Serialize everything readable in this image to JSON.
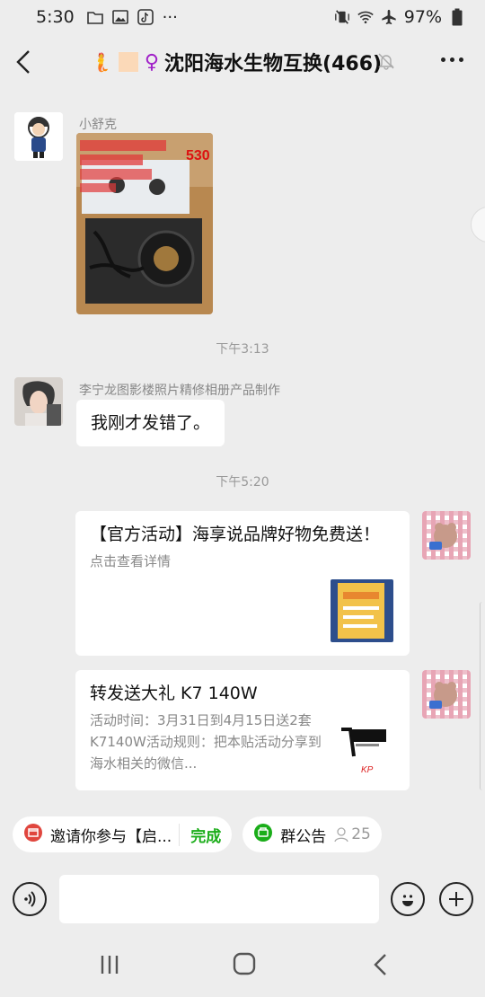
{
  "status_bar": {
    "time": "5:30",
    "battery": "97%"
  },
  "header": {
    "title_emoji": "🧜",
    "title": "沈阳海水生物互换(466)"
  },
  "messages": [
    {
      "sender": "小舒克",
      "type": "image",
      "image_overlay_text": "530"
    },
    {
      "type": "time",
      "text": "下午3:13"
    },
    {
      "sender": "李宁龙图影楼照片精修相册产品制作",
      "type": "text",
      "text": "我刚才发错了。"
    },
    {
      "type": "time",
      "text": "下午5:20"
    },
    {
      "type": "link_card",
      "title": "【官方活动】海享说品牌好物免费送！",
      "desc": "点击查看详情"
    },
    {
      "type": "link_card",
      "title": "转发送大礼 K7 140W",
      "desc": "活动时间：3月31日到4月15日送2套K7140W活动规则：把本贴活动分享到海水相关的微信..."
    }
  ],
  "tips": {
    "invite_text": "邀请你参与【启...",
    "invite_action": "完成",
    "announcement": "群公告",
    "members_count": "25"
  },
  "input": {
    "placeholder": ""
  },
  "icons": {
    "voice": "voice-icon",
    "emoji": "emoji-icon",
    "plus": "plus-icon"
  },
  "colors": {
    "background": "#ededed",
    "bubble": "#ffffff",
    "accent_green": "#1aad19",
    "title_purple": "#a020c8"
  }
}
